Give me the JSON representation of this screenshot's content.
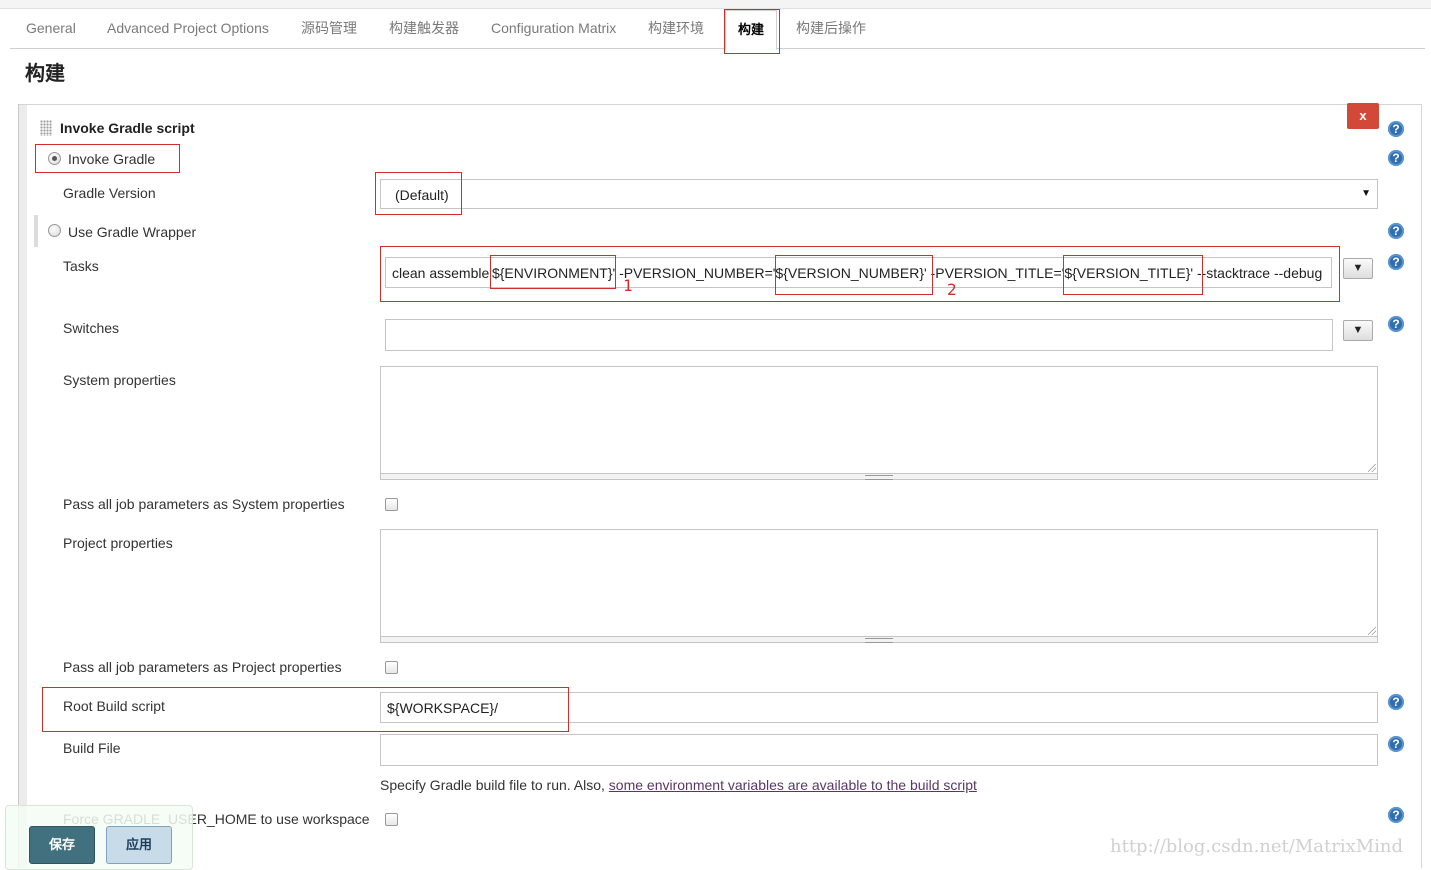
{
  "tabs": [
    {
      "label": "General"
    },
    {
      "label": "Advanced Project Options"
    },
    {
      "label": "源码管理"
    },
    {
      "label": "构建触发器"
    },
    {
      "label": "Configuration Matrix"
    },
    {
      "label": "构建环境"
    },
    {
      "label": "构建",
      "active": true
    },
    {
      "label": "构建后操作"
    }
  ],
  "section_title": "构建",
  "step": {
    "title": "Invoke Gradle script",
    "delete_label": "x",
    "help_glyph": "?",
    "invoke_gradle_label": "Invoke Gradle",
    "gradle_version_label": "Gradle Version",
    "gradle_version_value": "(Default)",
    "use_wrapper_label": "Use Gradle Wrapper",
    "tasks_label": "Tasks",
    "tasks_value": "clean assemble'${ENVIRONMENT}'  -PVERSION_NUMBER='${VERSION_NUMBER}' -PVERSION_TITLE='${VERSION_TITLE}' --stacktrace --debug",
    "switches_label": "Switches",
    "switches_value": "",
    "expand_glyph": "▼",
    "system_properties_label": "System properties",
    "pass_system_label": "Pass all job parameters as System properties",
    "project_properties_label": "Project properties",
    "pass_project_label": "Pass all job parameters as Project properties",
    "root_build_script_label": "Root Build script",
    "root_build_script_value": "${WORKSPACE}/",
    "build_file_label": "Build File",
    "build_file_value": "",
    "hint_prefix": "Specify Gradle build file to run. Also, ",
    "hint_link": "some environment variables are available to the build script",
    "force_home_label": "Force GRADLE_USER_HOME to use workspace"
  },
  "annotations": {
    "num1": "1",
    "num2": "2"
  },
  "buttons": {
    "save": "保存",
    "apply": "应用"
  },
  "watermark": "http://blog.csdn.net/MatrixMind",
  "colors": {
    "annotation": "#d42b2b",
    "help_icon": "#2f6fb0",
    "delete_button": "#d24939",
    "save_button": "#41717f"
  }
}
